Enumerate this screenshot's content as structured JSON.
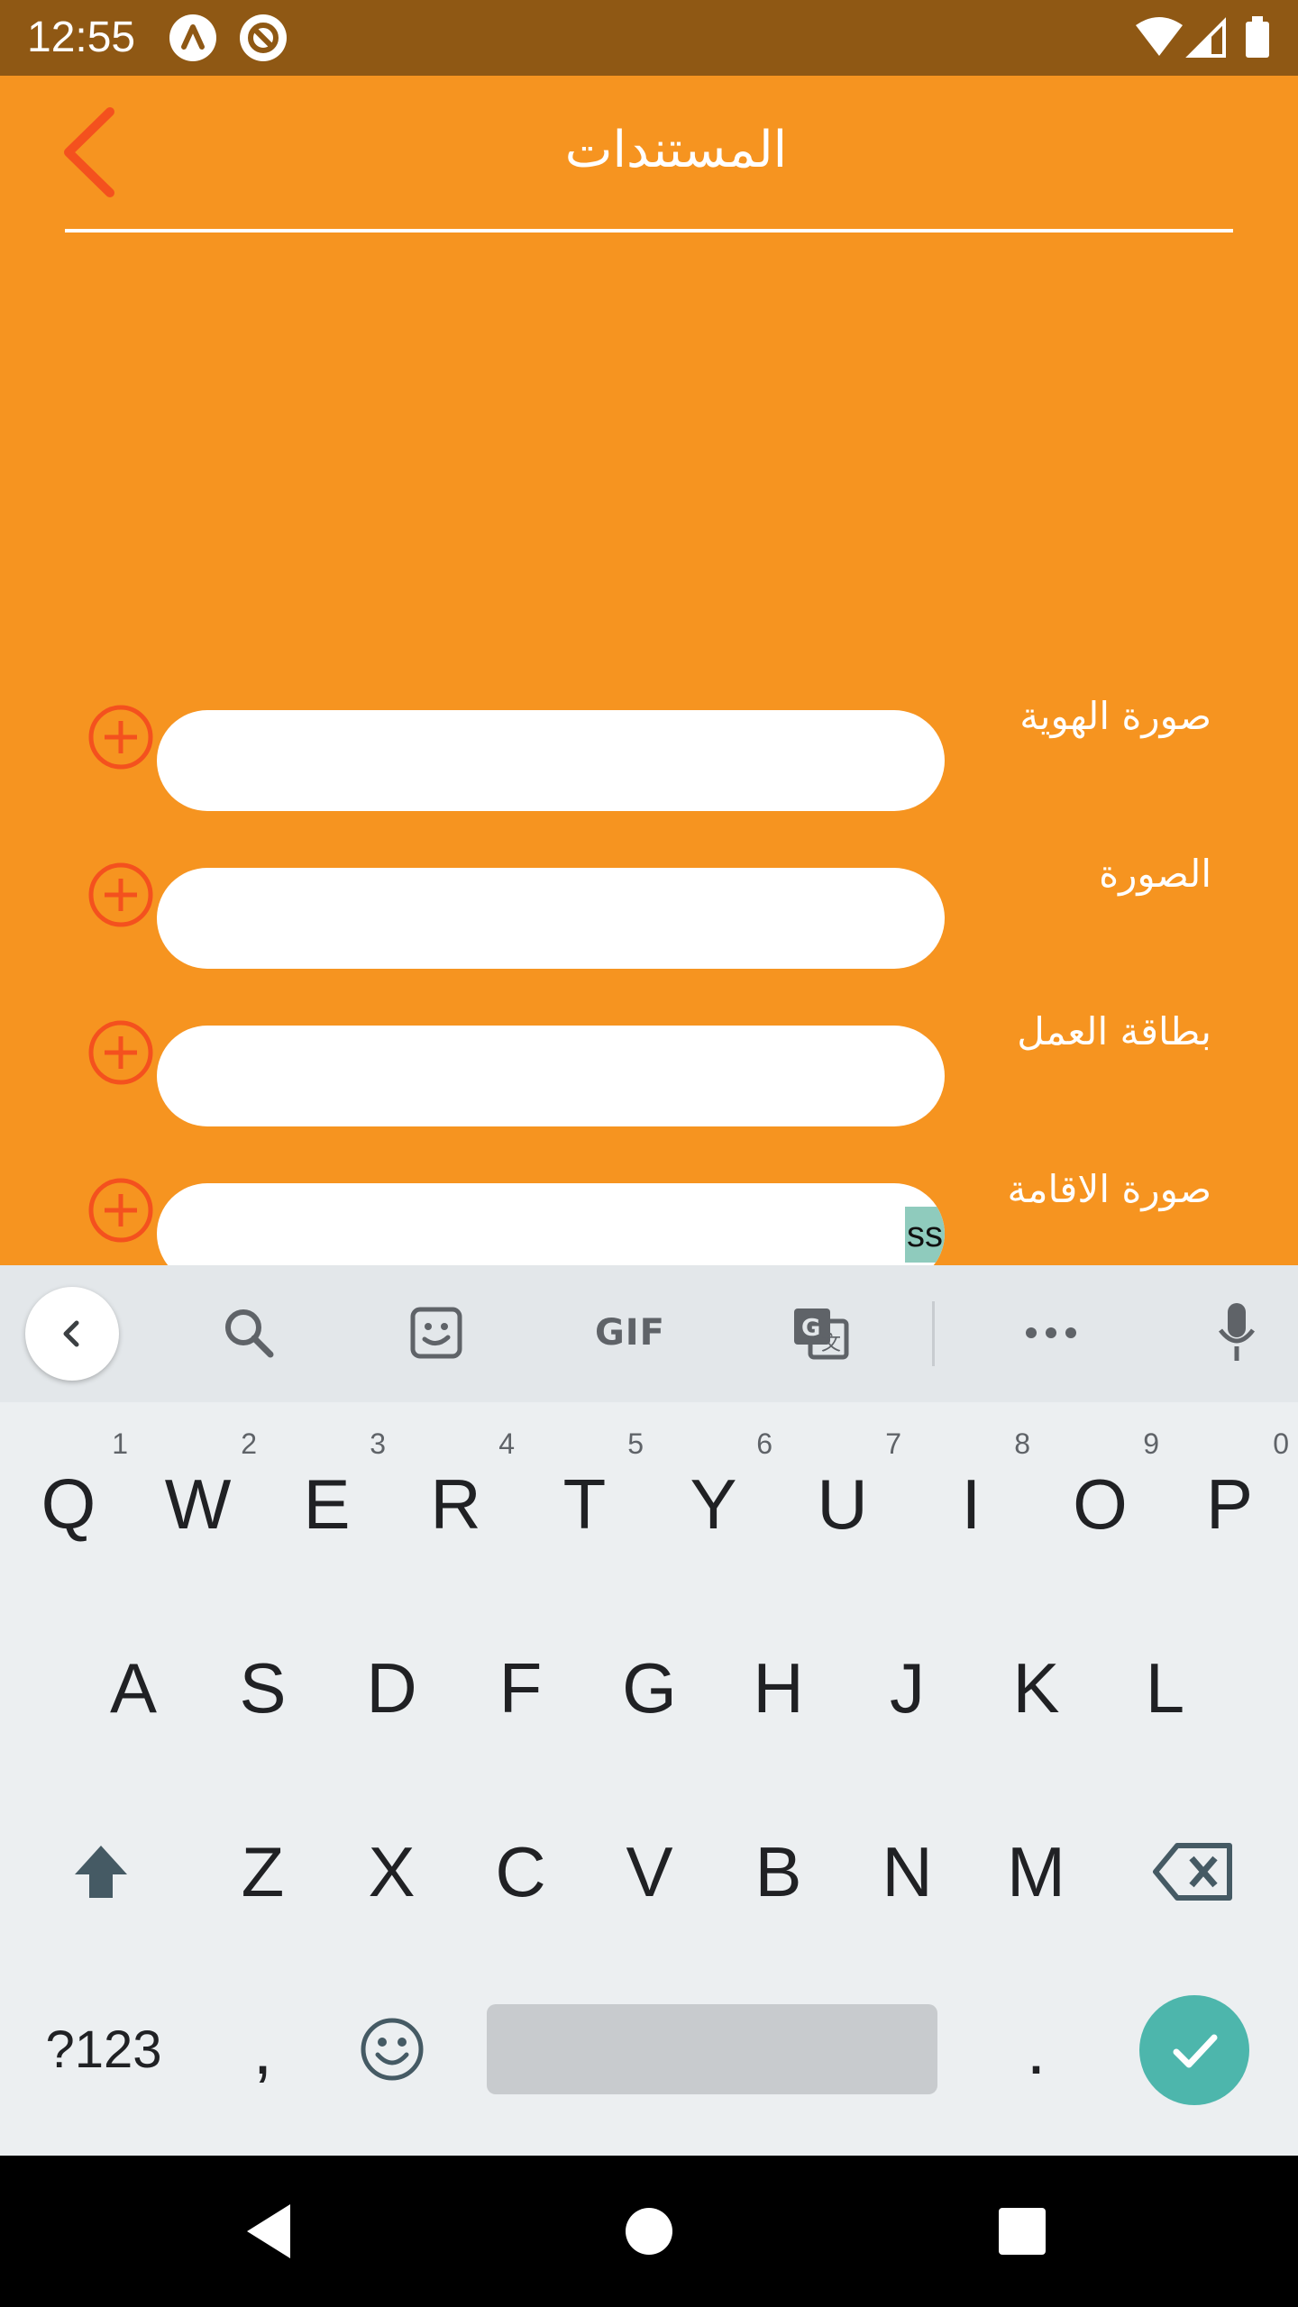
{
  "status_bar": {
    "time": "12:55",
    "left_icons": [
      "app-a-icon",
      "app-blocked-icon"
    ],
    "right_icons": [
      "wifi-icon",
      "signal-icon",
      "battery-icon"
    ]
  },
  "header": {
    "title": "المستندات",
    "back_icon": "chevron-left-icon",
    "accent_color": "#f4511e"
  },
  "background_color": "#f69420",
  "documents": [
    {
      "label": "صورة الهوية",
      "value": ""
    },
    {
      "label": "الصورة",
      "value": ""
    },
    {
      "label": "بطاقة العمل",
      "value": ""
    },
    {
      "label": "صورة الاقامة",
      "value": "ss"
    }
  ],
  "keyboard": {
    "toolbar_icons": [
      "chevron-left-icon",
      "search-icon",
      "sticker-icon",
      "gif-icon",
      "translate-icon",
      "more-icon",
      "mic-icon"
    ],
    "gif_label": "GIF",
    "row1": [
      {
        "key": "Q",
        "hint": "1"
      },
      {
        "key": "W",
        "hint": "2"
      },
      {
        "key": "E",
        "hint": "3"
      },
      {
        "key": "R",
        "hint": "4"
      },
      {
        "key": "T",
        "hint": "5"
      },
      {
        "key": "Y",
        "hint": "6"
      },
      {
        "key": "U",
        "hint": "7"
      },
      {
        "key": "I",
        "hint": "8"
      },
      {
        "key": "O",
        "hint": "9"
      },
      {
        "key": "P",
        "hint": "0"
      }
    ],
    "row2": [
      "A",
      "S",
      "D",
      "F",
      "G",
      "H",
      "J",
      "K",
      "L"
    ],
    "row3": [
      "Z",
      "X",
      "C",
      "V",
      "B",
      "N",
      "M"
    ],
    "symbols_label": "?123",
    "comma_label": ",",
    "period_label": ".",
    "enter_color": "#4db6ac"
  },
  "nav_bar": {
    "icons": [
      "nav-back-icon",
      "nav-home-icon",
      "nav-recents-icon"
    ]
  }
}
